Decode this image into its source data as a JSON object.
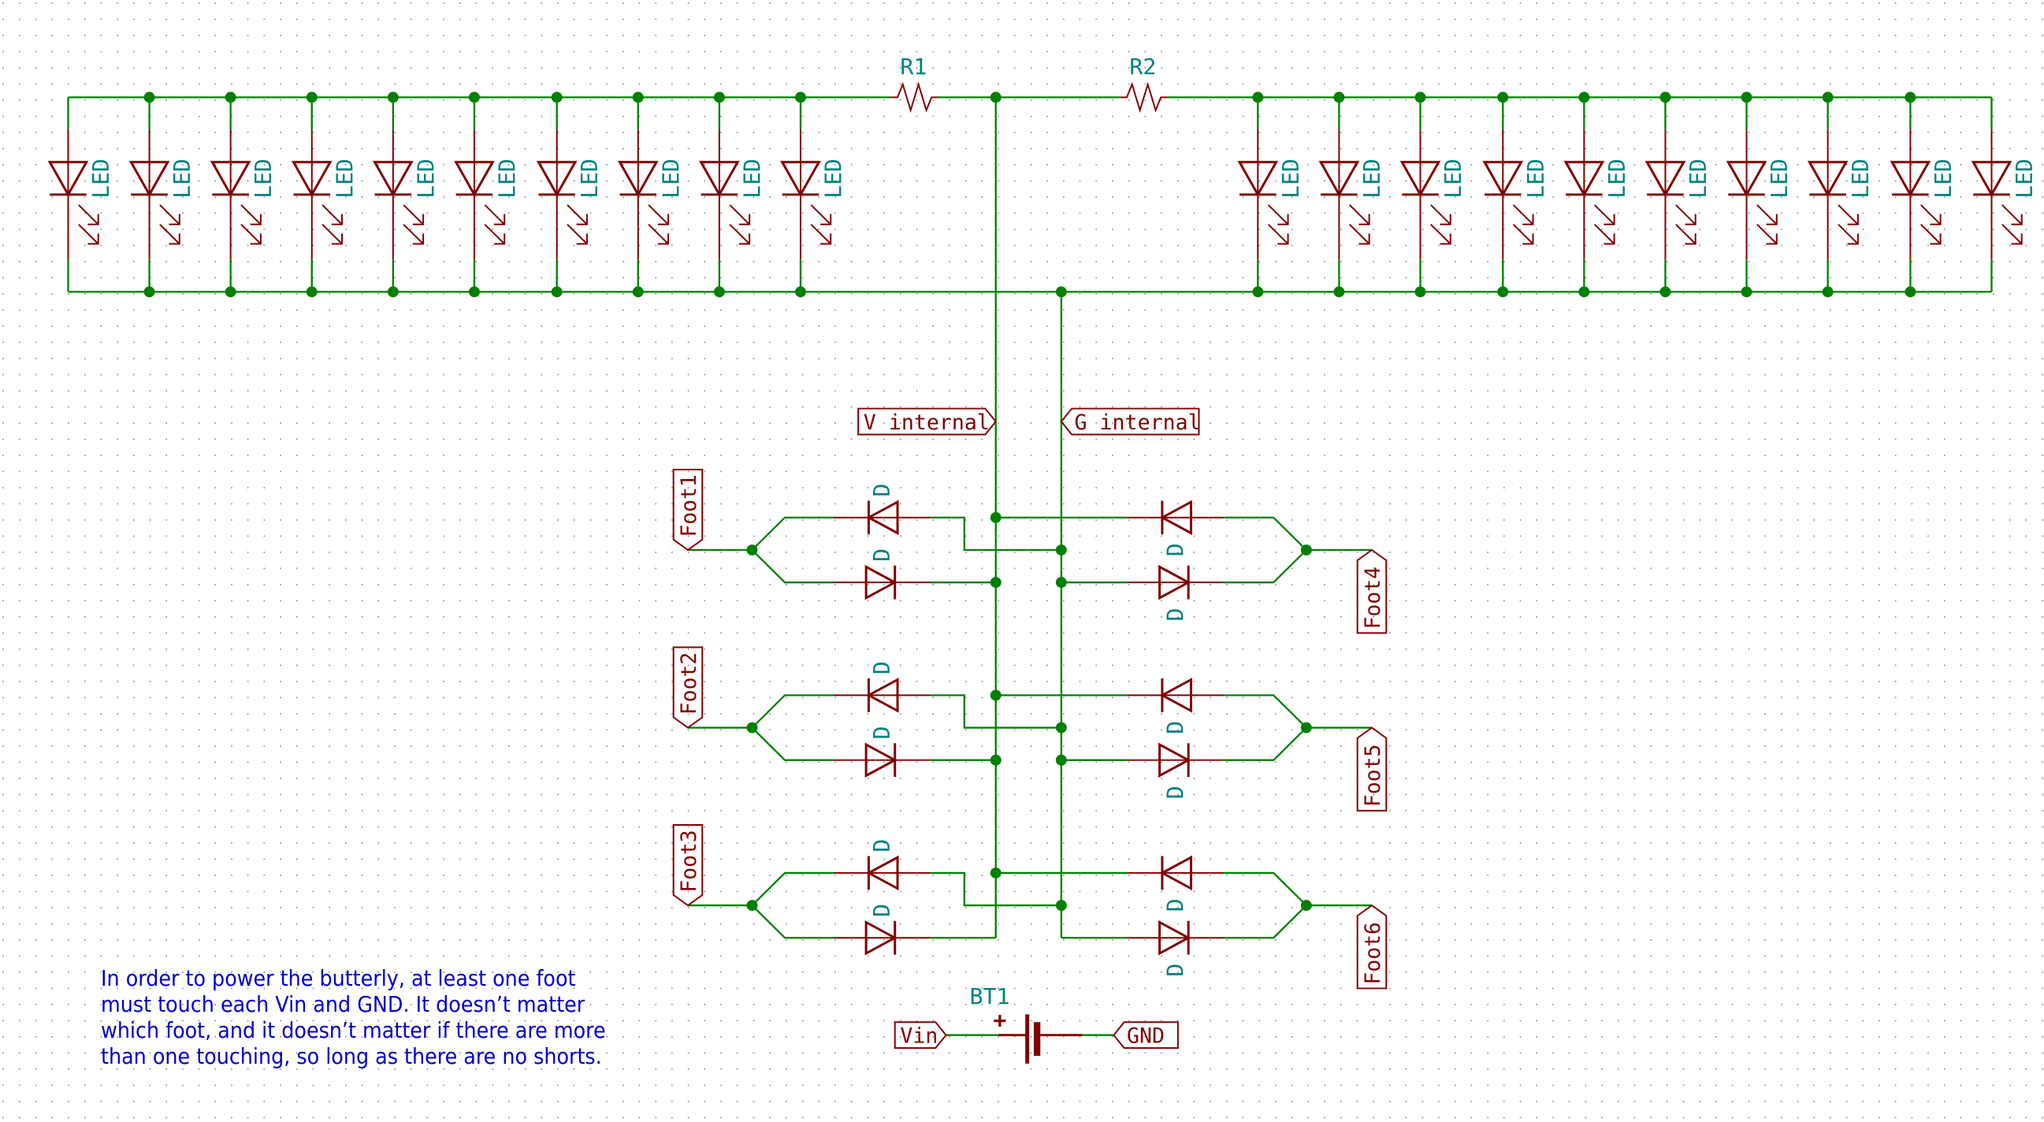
{
  "schematic": {
    "colors": {
      "wire": "#008000",
      "component": "#800000",
      "reference": "#008080",
      "note": "#0000c8",
      "grid": "#8c8c8c",
      "background": "#ffffff"
    },
    "resistors": [
      {
        "ref": "R1"
      },
      {
        "ref": "R2"
      }
    ],
    "led_value": "LED",
    "led_count_left": 10,
    "led_count_right": 10,
    "diode_value": "D",
    "net_labels": {
      "v_internal": "V_internal",
      "g_internal": "G_internal",
      "vin": "Vin",
      "gnd": "GND"
    },
    "feet": [
      "Foot1",
      "Foot2",
      "Foot3",
      "Foot4",
      "Foot5",
      "Foot6"
    ],
    "battery": {
      "ref": "BT1",
      "polarity": "+"
    },
    "note_lines": [
      "In order to power the butterly, at least one foot",
      "must touch each Vin and GND. It doesn’t matter",
      "which foot, and it doesn’t matter if there are more",
      "than one touching, so long as there are no shorts."
    ]
  }
}
